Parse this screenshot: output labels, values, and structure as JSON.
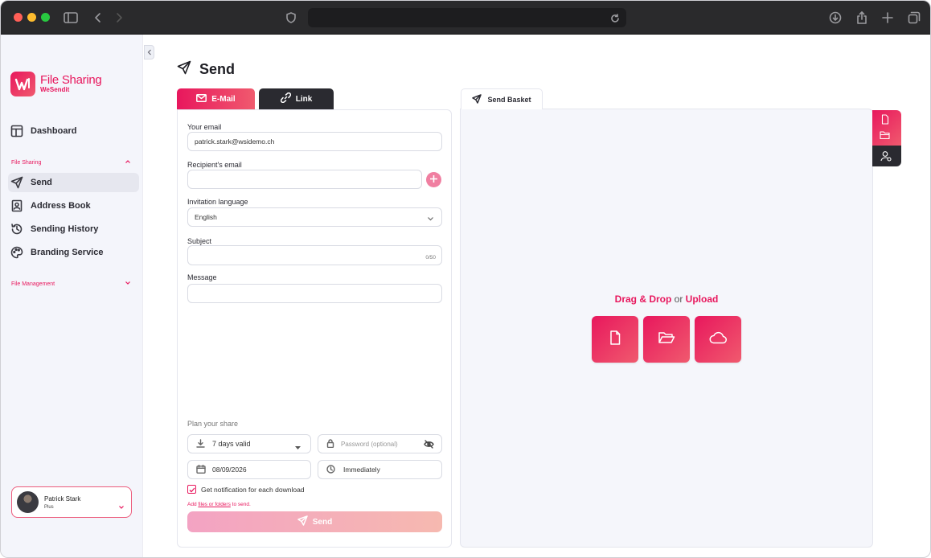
{
  "browser": {
    "url": ""
  },
  "sidebar": {
    "logo": {
      "title": "File Sharing",
      "subtitle": "WeSendit"
    },
    "dashboard": "Dashboard",
    "file_sharing_section": "File Sharing",
    "items": [
      {
        "label": "Send",
        "icon": "send-icon",
        "active": true
      },
      {
        "label": "Address Book",
        "icon": "address-book-icon"
      },
      {
        "label": "Sending History",
        "icon": "history-icon"
      },
      {
        "label": "Branding Service",
        "icon": "palette-icon"
      }
    ],
    "file_management_section": "File Management",
    "user": {
      "name": "Patrick Stark",
      "plan": "Plus"
    }
  },
  "main": {
    "title": "Send",
    "tabs": [
      {
        "label": "E-Mail"
      },
      {
        "label": "Link"
      }
    ],
    "form": {
      "your_email_label": "Your email",
      "your_email_value": "patrick.stark@wsidemo.ch",
      "recipient_label": "Recipient's email",
      "recipient_value": "",
      "language_label": "Invitation language",
      "language_value": "English",
      "subject_label": "Subject",
      "subject_counter": "0/50",
      "message_label": "Message",
      "plan_label": "Plan your share",
      "validity": "7 days valid",
      "password_placeholder": "Password (optional)",
      "date": "08/09/2026",
      "timing": "Immediately",
      "notification_label": "Get notification for each download",
      "notification_checked": true,
      "hint_prefix": "Add ",
      "hint_link": "files or folders",
      "hint_suffix": " to send.",
      "send_button": "Send"
    },
    "basket": {
      "tab_label": "Send Basket",
      "drag_drop": "Drag & Drop",
      "or": " or ",
      "upload": "Upload"
    }
  },
  "colors": {
    "accent": "#e8175d",
    "accent_light": "#f05a6e",
    "dark": "#2a2a30"
  }
}
